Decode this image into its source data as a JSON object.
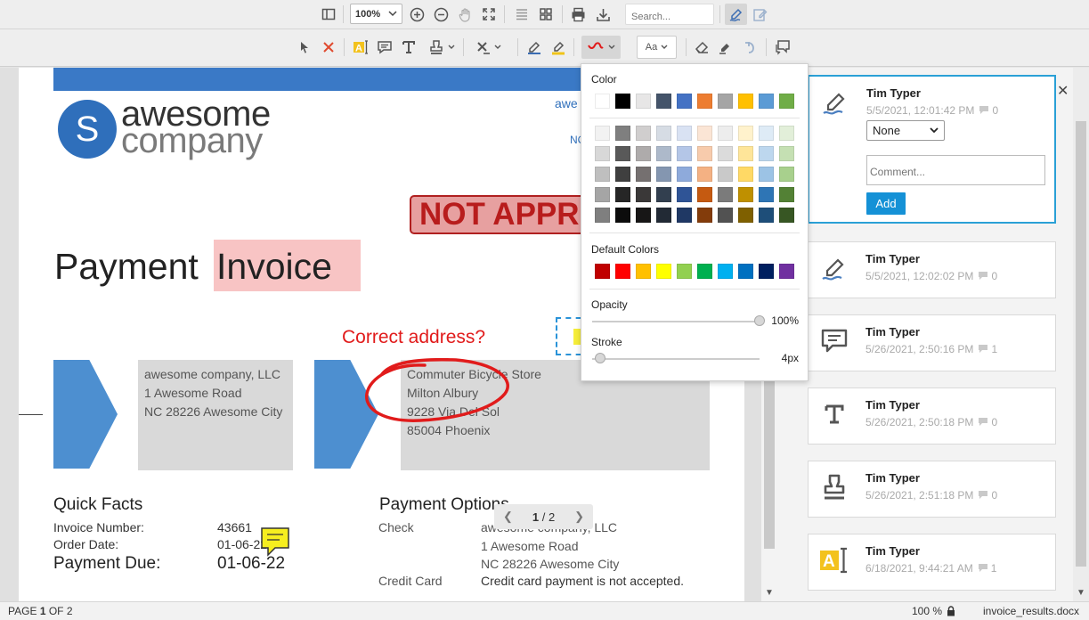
{
  "toolbar_top": {
    "zoom_value": "100%",
    "search_placeholder": "Search..."
  },
  "toolbar_annot": {
    "font_button_label": "Aa"
  },
  "document": {
    "logo_line1": "awesome",
    "logo_line2": "company",
    "logo_letter": "S",
    "corner_text": "awe",
    "corner_text2": "NC",
    "stamp_text": "NOT APPR",
    "title_part1": "Payment",
    "title_part2": "Invoice",
    "free_text_annotation": "Correct address?",
    "sender_address": [
      "awesome company, LLC",
      "1 Awesome Road",
      "NC 28226 Awesome City"
    ],
    "recipient_address": [
      "Commuter Bicycle Store",
      "Milton Albury",
      "9228 Via Del Sol",
      "85004 Phoenix"
    ],
    "quick_facts_title": "Quick Facts",
    "invoice_number_label": "Invoice Number:",
    "invoice_number_value": "43661",
    "order_date_label": "Order Date:",
    "order_date_value": "01-06-22",
    "payment_due_label": "Payment Due:",
    "payment_due_value": "01-06-22",
    "payment_options_title": "Payment Options",
    "check_label": "Check",
    "check_lines": [
      "awesome company, LLC",
      "1 Awesome Road",
      "NC 28226 Awesome City"
    ],
    "credit_card_label": "Credit Card",
    "credit_card_text": "Credit card payment is not accepted."
  },
  "pager": {
    "current": "1",
    "separator": "/",
    "total": "2"
  },
  "color_popup": {
    "color_label": "Color",
    "default_colors_label": "Default Colors",
    "opacity_label": "Opacity",
    "opacity_value": "100%",
    "opacity_fraction": 1.0,
    "stroke_label": "Stroke",
    "stroke_value": "4px",
    "stroke_fraction": 0.05,
    "theme_colors": [
      "#ffffff",
      "#000000",
      "#e7e6e6",
      "#44546a",
      "#4472c4",
      "#ed7d31",
      "#a5a5a5",
      "#ffc000",
      "#5b9bd5",
      "#70ad47"
    ],
    "shade_rows": [
      [
        "#f2f2f2",
        "#7f7f7f",
        "#d0cece",
        "#d6dce4",
        "#d9e2f3",
        "#fbe5d5",
        "#ededed",
        "#fff2cc",
        "#deebf6",
        "#e2efd9"
      ],
      [
        "#d8d8d8",
        "#595959",
        "#aeabab",
        "#adb9ca",
        "#b4c6e7",
        "#f7cbac",
        "#dbdbdb",
        "#fee599",
        "#bdd7ee",
        "#c5e0b3"
      ],
      [
        "#bfbfbf",
        "#3f3f3f",
        "#757070",
        "#8496b0",
        "#8eaadb",
        "#f4b183",
        "#c9c9c9",
        "#ffd965",
        "#9cc3e5",
        "#a8d08d"
      ],
      [
        "#a5a5a5",
        "#262626",
        "#3a3838",
        "#323f4f",
        "#2f5496",
        "#c55a11",
        "#7b7b7b",
        "#bf9000",
        "#2e75b5",
        "#538135"
      ],
      [
        "#7f7f7f",
        "#0c0c0c",
        "#171616",
        "#222a35",
        "#1f3864",
        "#833c0b",
        "#525252",
        "#7f6000",
        "#1e4e79",
        "#375623"
      ]
    ],
    "default_colors": [
      "#c00000",
      "#ff0000",
      "#ffc000",
      "#ffff00",
      "#92d050",
      "#00b050",
      "#00b0f0",
      "#0070c0",
      "#002060",
      "#7030a0"
    ]
  },
  "annotations_panel": {
    "status_option": "None",
    "comment_placeholder": "Comment...",
    "add_button_label": "Add",
    "close_symbol": "✕",
    "cards": [
      {
        "author": "Tim Typer",
        "date": "5/5/2021, 12:01:42 PM",
        "replies": "0",
        "icon": "signature-icon"
      },
      {
        "author": "Tim Typer",
        "date": "5/5/2021, 12:02:02 PM",
        "replies": "0",
        "icon": "signature-icon"
      },
      {
        "author": "Tim Typer",
        "date": "5/26/2021, 2:50:16 PM",
        "replies": "1",
        "icon": "comment-icon"
      },
      {
        "author": "Tim Typer",
        "date": "5/26/2021, 2:50:18 PM",
        "replies": "0",
        "icon": "text-icon"
      },
      {
        "author": "Tim Typer",
        "date": "5/26/2021, 2:51:18 PM",
        "replies": "0",
        "icon": "stamp-icon"
      },
      {
        "author": "Tim Typer",
        "date": "6/18/2021, 9:44:21 AM",
        "replies": "1",
        "icon": "text-field-icon"
      }
    ]
  },
  "status_bar": {
    "page_prefix": "PAGE",
    "page_current": "1",
    "page_of": "OF 2",
    "zoom": "100 %",
    "filename": "invoice_results.docx"
  },
  "colors": {
    "accent": "#2aa0d6",
    "add_button": "#1591d6",
    "doc_blue": "#3a79c6",
    "stamp_red": "#b81c1c",
    "ink_red": "#e11b1b"
  }
}
